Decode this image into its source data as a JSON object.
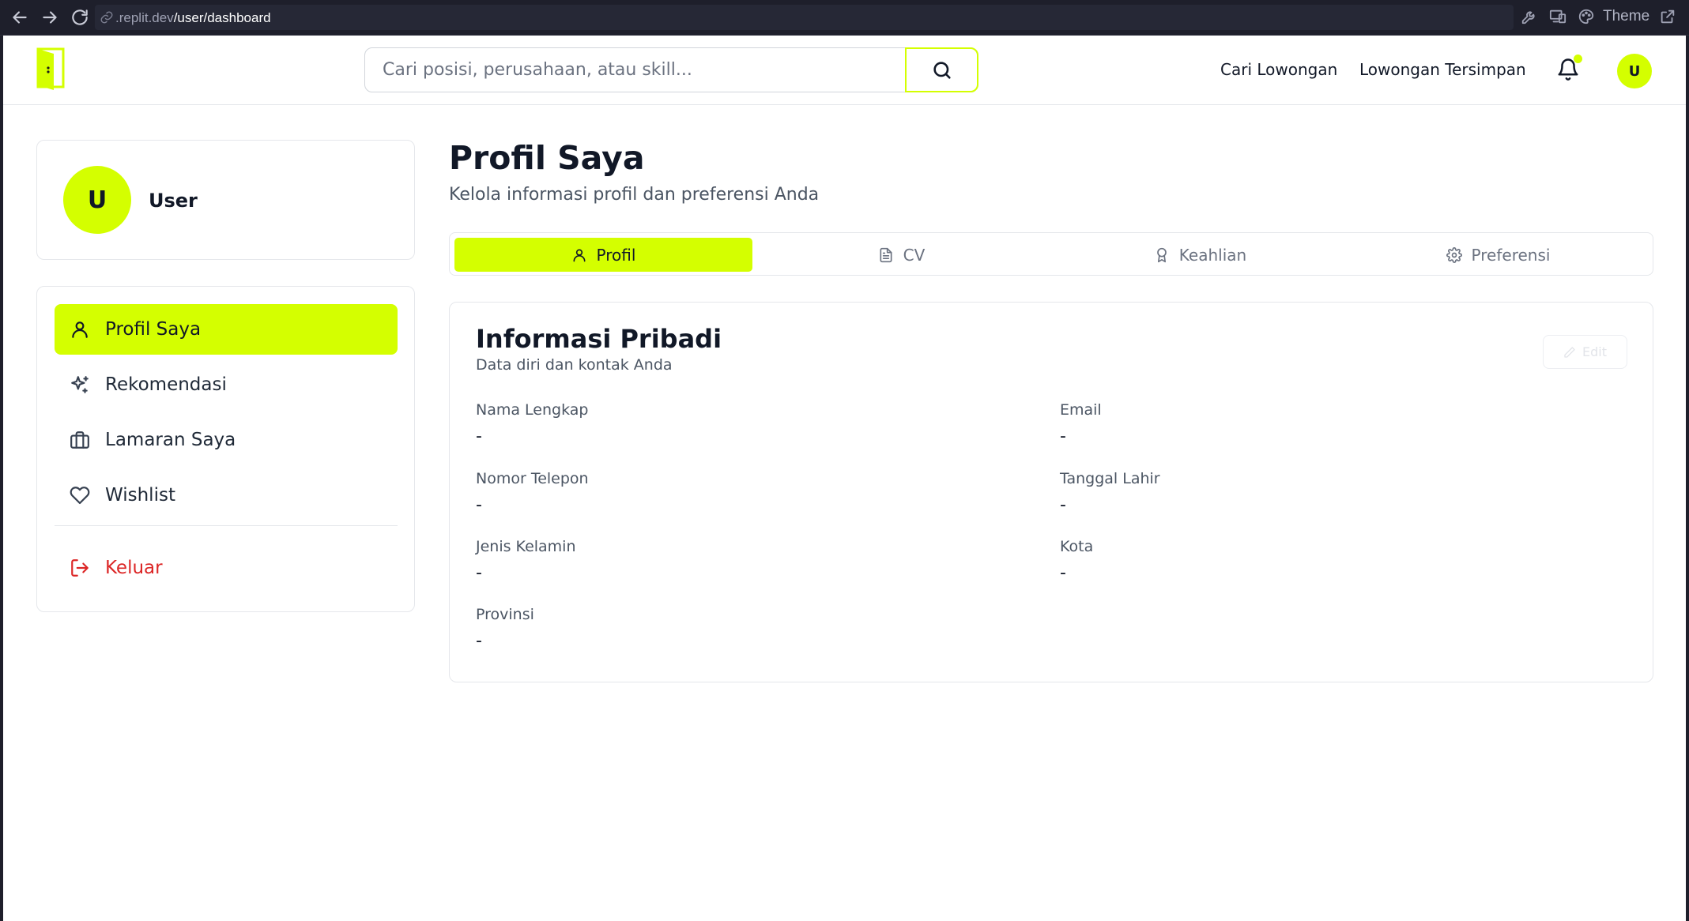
{
  "browser": {
    "url_domain": ".replit.dev",
    "url_path": "/user/dashboard",
    "theme_label": "Theme"
  },
  "header": {
    "search_placeholder": "Cari posisi, perusahaan, atau skill...",
    "links": [
      "Cari Lowongan",
      "Lowongan Tersimpan"
    ],
    "avatar_initial": "U",
    "accent_color": "#d4ff00"
  },
  "sidebar": {
    "avatar_initial": "U",
    "user_name": "User",
    "items": [
      {
        "label": "Profil Saya",
        "icon": "user-icon",
        "active": true
      },
      {
        "label": "Rekomendasi",
        "icon": "sparkles-icon",
        "active": false
      },
      {
        "label": "Lamaran Saya",
        "icon": "briefcase-icon",
        "active": false
      },
      {
        "label": "Wishlist",
        "icon": "heart-icon",
        "active": false
      }
    ],
    "logout_label": "Keluar",
    "logout_color": "#dc2626"
  },
  "main": {
    "title": "Profil Saya",
    "subtitle": "Kelola informasi profil dan preferensi Anda",
    "tabs": [
      {
        "label": "Profil",
        "icon": "user-icon",
        "active": true
      },
      {
        "label": "CV",
        "icon": "file-icon",
        "active": false
      },
      {
        "label": "Keahlian",
        "icon": "award-icon",
        "active": false
      },
      {
        "label": "Preferensi",
        "icon": "gear-icon",
        "active": false
      }
    ],
    "card": {
      "title": "Informasi Pribadi",
      "subtitle": "Data diri dan kontak Anda",
      "edit_label": "Edit",
      "fields": [
        {
          "label": "Nama Lengkap",
          "value": "-"
        },
        {
          "label": "Email",
          "value": "-"
        },
        {
          "label": "Nomor Telepon",
          "value": "-"
        },
        {
          "label": "Tanggal Lahir",
          "value": "-"
        },
        {
          "label": "Jenis Kelamin",
          "value": "-"
        },
        {
          "label": "Kota",
          "value": "-"
        },
        {
          "label": "Provinsi",
          "value": "-"
        }
      ]
    }
  }
}
